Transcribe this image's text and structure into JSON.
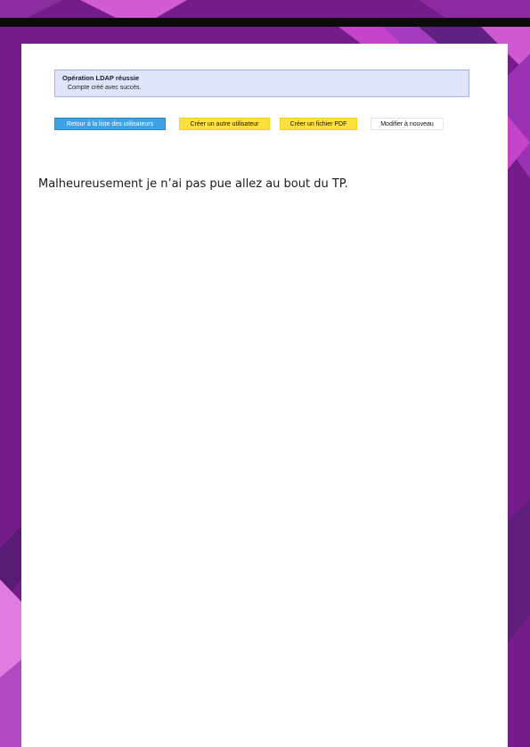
{
  "notice": {
    "title": "Opération LDAP réussie",
    "message": "Compte créé avec succès."
  },
  "actions": {
    "back_label": "Retour à la liste des utilisateurs",
    "create_another_label": "Créer un autre utilisateur",
    "pdf_label": "Créer un fichier PDF",
    "edit_again_label": "Modifier à nouveau"
  },
  "content": {
    "text": "Malheureusement je n’ai pas pue allez au bout du TP."
  },
  "colors": {
    "background_purple": "#741d8a",
    "accent_pink": "#c443c9",
    "notice_bg": "#dfe6fb",
    "primary_button": "#3ea2e6",
    "secondary_button": "#ffe03d"
  }
}
